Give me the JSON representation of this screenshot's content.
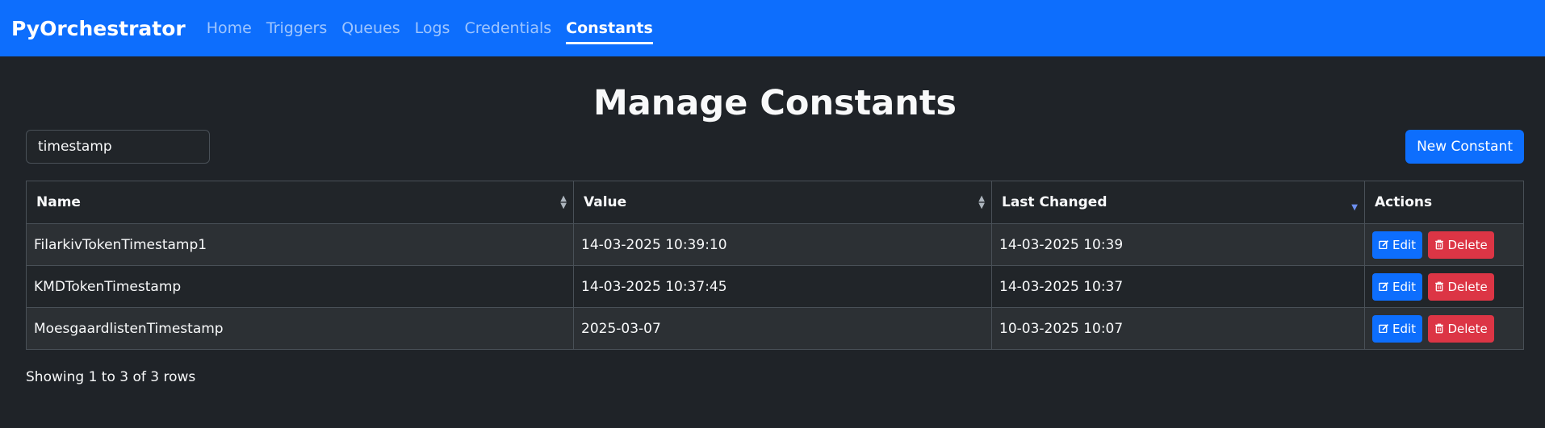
{
  "navbar": {
    "brand": "PyOrchestrator",
    "links": [
      {
        "label": "Home"
      },
      {
        "label": "Triggers"
      },
      {
        "label": "Queues"
      },
      {
        "label": "Logs"
      },
      {
        "label": "Credentials"
      },
      {
        "label": "Constants",
        "active": true
      }
    ]
  },
  "page": {
    "title": "Manage Constants"
  },
  "search": {
    "value": "timestamp"
  },
  "toolbar": {
    "new_label": "New Constant"
  },
  "table": {
    "columns": [
      "Name",
      "Value",
      "Last Changed",
      "Actions"
    ],
    "sort": {
      "column": "Last Changed",
      "direction": "desc"
    },
    "rows": [
      {
        "name": "FilarkivTokenTimestamp1",
        "value": "14-03-2025 10:39:10",
        "last_changed": "14-03-2025 10:39"
      },
      {
        "name": "KMDTokenTimestamp",
        "value": "14-03-2025 10:37:45",
        "last_changed": "14-03-2025 10:37"
      },
      {
        "name": "MoesgaardlistenTimestamp",
        "value": "2025-03-07",
        "last_changed": "10-03-2025 10:07"
      }
    ],
    "edit_label": "Edit",
    "delete_label": "Delete",
    "footer": "Showing 1 to 3 of 3 rows"
  },
  "colors": {
    "navbar": "#0d6efd",
    "background": "#1f2328",
    "primary": "#0d6efd",
    "danger": "#dc3545"
  },
  "icons": {
    "sortable": "sort-icon",
    "sort_desc": "sort-desc-icon",
    "edit": "edit-icon",
    "delete": "trash-icon"
  }
}
